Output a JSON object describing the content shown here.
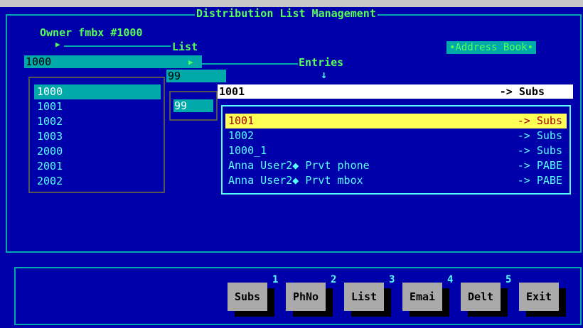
{
  "window": {
    "title": "Distribution List Management"
  },
  "owner": {
    "label": "Owner fmbx #1000"
  },
  "labels": {
    "list": "List",
    "entries": "Entries"
  },
  "address_book": {
    "label": "•Address Book•"
  },
  "list_field": {
    "value": "1000"
  },
  "count_field": {
    "value": "99"
  },
  "count_box": {
    "value": "99"
  },
  "lists": [
    {
      "label": "1000",
      "selected": true
    },
    {
      "label": "1001"
    },
    {
      "label": "1002"
    },
    {
      "label": "1003"
    },
    {
      "label": "2000"
    },
    {
      "label": "2001"
    },
    {
      "label": "2002"
    }
  ],
  "entry_input": {
    "name": "1001",
    "type": "-> Subs"
  },
  "entries": [
    {
      "name": "1001",
      "type": "-> Subs",
      "selected": true
    },
    {
      "name": "1002",
      "type": "-> Subs"
    },
    {
      "name": "1000_1",
      "type": "-> Subs"
    },
    {
      "name": "Anna User2◆ Prvt phone",
      "type": "-> PABE"
    },
    {
      "name": "Anna User2◆ Prvt mbox",
      "type": "-> PABE"
    }
  ],
  "buttons": [
    {
      "label": "Subs",
      "fkey": "1"
    },
    {
      "label": "PhNo",
      "fkey": "2"
    },
    {
      "label": "List",
      "fkey": "3"
    },
    {
      "label": "Emai",
      "fkey": "4"
    },
    {
      "label": "Delt",
      "fkey": "5"
    },
    {
      "label": "Exit",
      "fkey": ""
    }
  ],
  "colors": {
    "background": "#0000AA",
    "frame": "#00AAAA",
    "title": "#55FF55",
    "highlight": "#FFFF55",
    "highlight_text": "#AA0000",
    "button": "#AAAAAA"
  }
}
